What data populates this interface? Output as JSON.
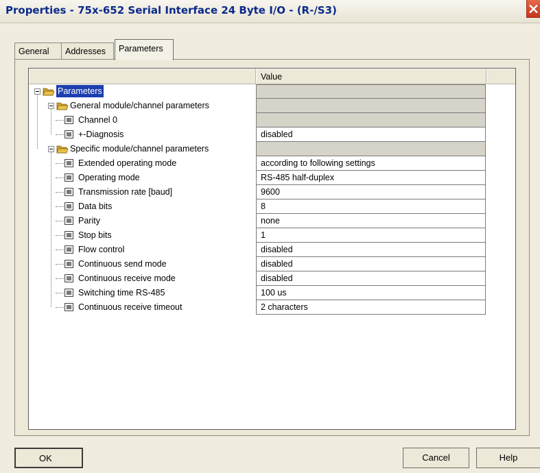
{
  "window": {
    "title": "Properties - 75x-652 Serial Interface 24 Byte I/O - (R-/S3)",
    "close_icon": "close-icon"
  },
  "tabs": [
    {
      "label": "General",
      "active": false
    },
    {
      "label": "Addresses",
      "active": false
    },
    {
      "label": "Parameters",
      "active": true
    }
  ],
  "grid": {
    "columns": {
      "name": "",
      "value": "Value"
    },
    "rows": [
      {
        "level": 0,
        "type": "folder",
        "label": "Parameters",
        "value": "",
        "value_style": "grey",
        "selected": true
      },
      {
        "level": 1,
        "type": "folder",
        "label": "General module/channel parameters",
        "value": "",
        "value_style": "grey"
      },
      {
        "level": 2,
        "type": "param",
        "label": "Channel 0",
        "value": "",
        "value_style": "grey"
      },
      {
        "level": 2,
        "type": "param",
        "label": "+-Diagnosis",
        "value": "disabled",
        "value_style": "white"
      },
      {
        "level": 1,
        "type": "folder",
        "label": "Specific module/channel parameters",
        "value": "",
        "value_style": "grey"
      },
      {
        "level": 2,
        "type": "param",
        "label": "Extended operating mode",
        "value": "according to following settings",
        "value_style": "white"
      },
      {
        "level": 2,
        "type": "param",
        "label": "Operating mode",
        "value": "RS-485 half-duplex",
        "value_style": "white"
      },
      {
        "level": 2,
        "type": "param",
        "label": "Transmission rate [baud]",
        "value": "9600",
        "value_style": "white"
      },
      {
        "level": 2,
        "type": "param",
        "label": "Data bits",
        "value": "8",
        "value_style": "white"
      },
      {
        "level": 2,
        "type": "param",
        "label": "Parity",
        "value": "none",
        "value_style": "white"
      },
      {
        "level": 2,
        "type": "param",
        "label": "Stop bits",
        "value": "1",
        "value_style": "white"
      },
      {
        "level": 2,
        "type": "param",
        "label": "Flow control",
        "value": "disabled",
        "value_style": "white"
      },
      {
        "level": 2,
        "type": "param",
        "label": "Continuous send mode",
        "value": "disabled",
        "value_style": "white"
      },
      {
        "level": 2,
        "type": "param",
        "label": "Continuous receive mode",
        "value": "disabled",
        "value_style": "white"
      },
      {
        "level": 2,
        "type": "param",
        "label": "Switching time RS-485",
        "value": "100 us",
        "value_style": "white"
      },
      {
        "level": 2,
        "type": "param",
        "label": "Continuous receive timeout",
        "value": "2 characters",
        "value_style": "white"
      }
    ]
  },
  "buttons": {
    "ok": "OK",
    "cancel": "Cancel",
    "help": "Help"
  },
  "colors": {
    "selection": "#1c3fb0",
    "title_text": "#0a2a8a",
    "close_button": "#c6361b",
    "folder": "#e8c24a"
  }
}
